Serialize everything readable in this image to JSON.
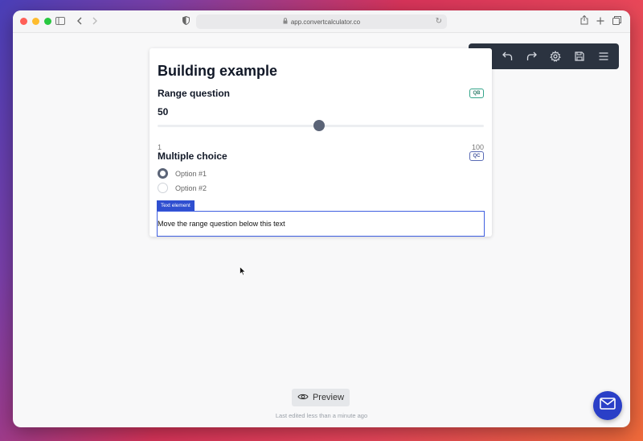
{
  "browser": {
    "url": "app.convertcalculator.co"
  },
  "form": {
    "title": "Building example",
    "range_question": {
      "label": "Range question",
      "badge": "QB",
      "value": 50,
      "min": 1,
      "max": 100,
      "min_label": "1",
      "max_label": "100",
      "value_label": "50"
    },
    "multiple_choice": {
      "label": "Multiple choice",
      "badge": "QC",
      "options": [
        {
          "label": "Option #1",
          "selected": true
        },
        {
          "label": "Option #2",
          "selected": false
        }
      ]
    },
    "text_element": {
      "tag": "Text element",
      "content": "Move the range question below this text"
    }
  },
  "toolbar": {
    "icons": [
      "plus-icon",
      "undo-icon",
      "redo-icon",
      "gear-icon",
      "save-icon",
      "menu-icon"
    ]
  },
  "footer": {
    "preview_label": "Preview",
    "last_edited": "Last edited less than a minute ago"
  },
  "colors": {
    "toolbar_bg": "#2b3340",
    "accent_blue": "#2f4fd0",
    "slider_thumb": "#5b6477",
    "mail_button": "#2a3fc7"
  }
}
